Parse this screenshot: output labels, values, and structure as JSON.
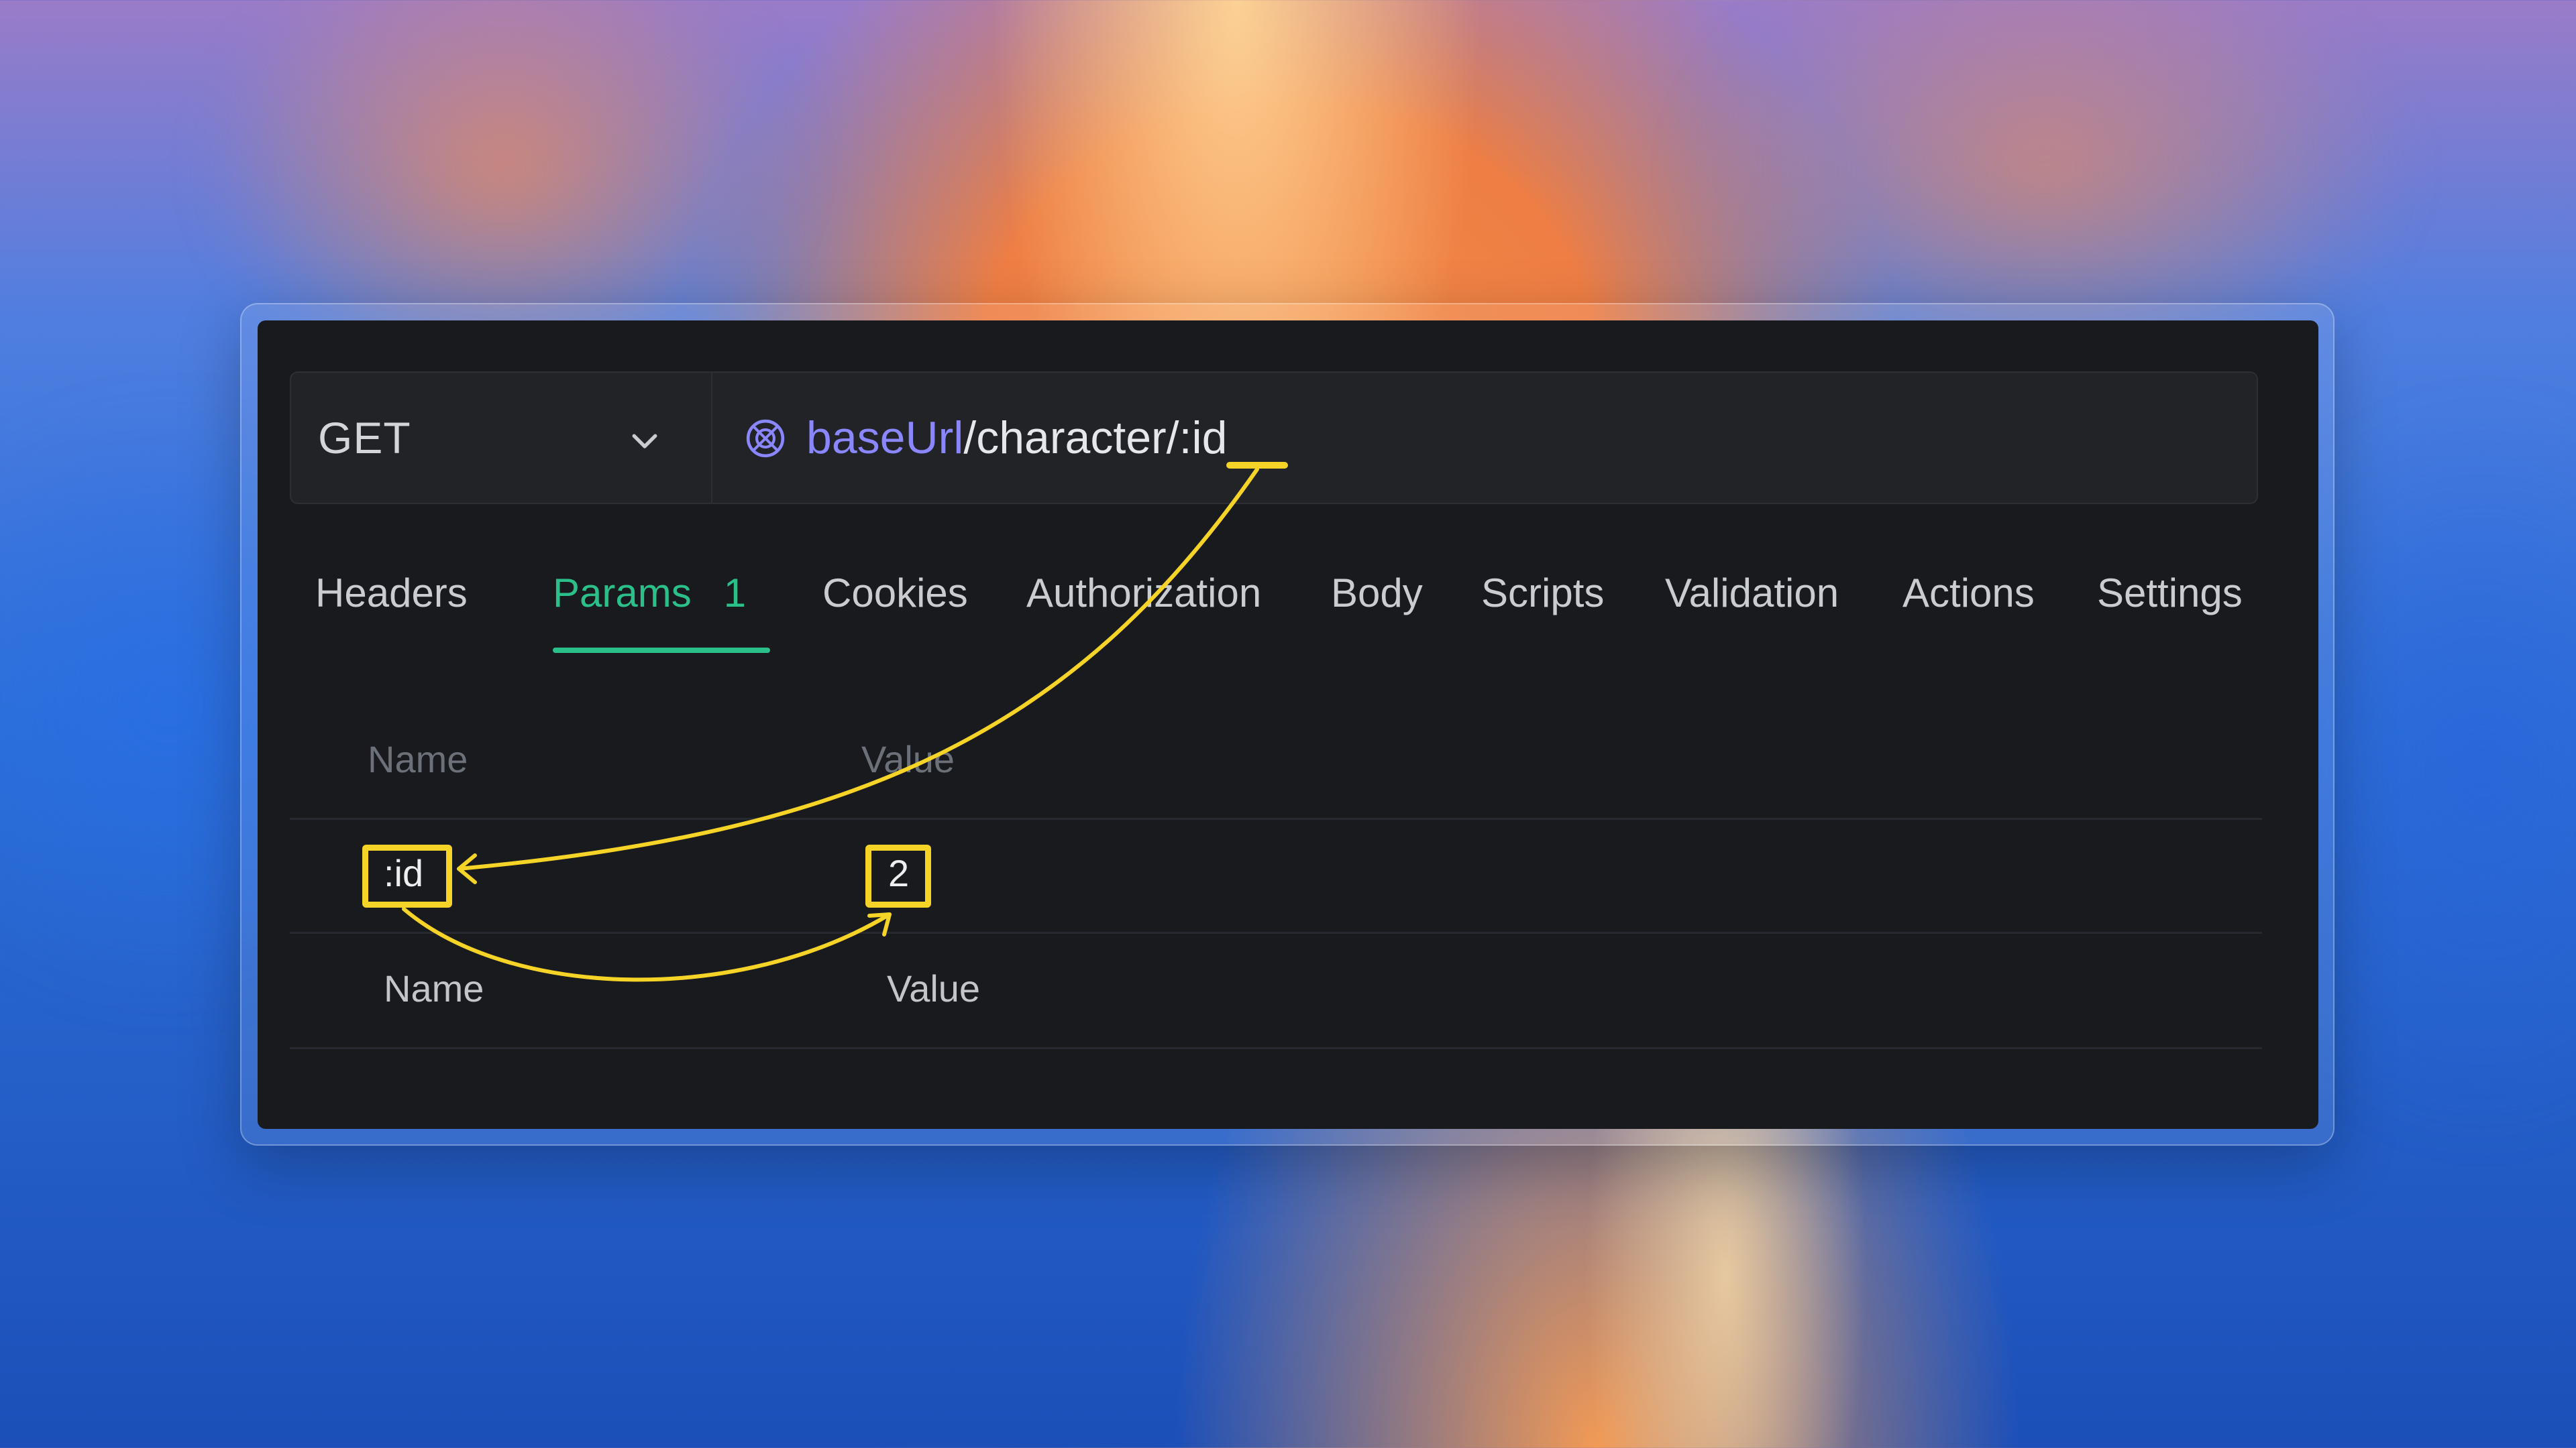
{
  "request": {
    "method": "GET",
    "url": {
      "variable": "baseUrl",
      "path": "/character/:id"
    }
  },
  "tabs": [
    {
      "label": "Headers"
    },
    {
      "label": "Params",
      "count": "1",
      "active": true
    },
    {
      "label": "Cookies"
    },
    {
      "label": "Authorization"
    },
    {
      "label": "Body"
    },
    {
      "label": "Scripts"
    },
    {
      "label": "Validation"
    },
    {
      "label": "Actions"
    },
    {
      "label": "Settings"
    }
  ],
  "params": {
    "columns": [
      "Name",
      "Value"
    ],
    "rows": [
      {
        "name": ":id",
        "value": "2"
      }
    ],
    "new_row": {
      "name_placeholder": "Name",
      "value_placeholder": "Value"
    }
  },
  "colors": {
    "accent": "#2bc08a",
    "variable": "#8a86ff",
    "annotation": "#f5d327"
  },
  "icons": {
    "method_dropdown": "chevron-down-icon",
    "url_variable": "globe-icon"
  }
}
